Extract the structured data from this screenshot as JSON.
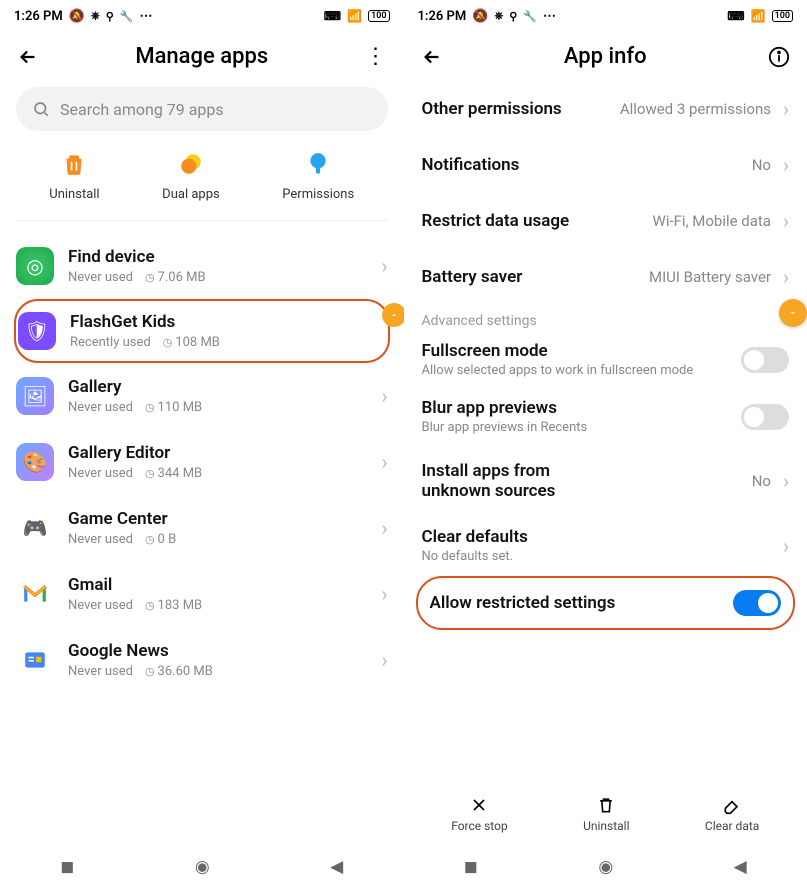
{
  "status": {
    "time": "1:26 PM",
    "battery_text": "100"
  },
  "screen1": {
    "title": "Manage apps",
    "search_placeholder": "Search among 79 apps",
    "quick_actions": {
      "uninstall": "Uninstall",
      "dual": "Dual apps",
      "permissions": "Permissions"
    },
    "apps": [
      {
        "name": "Find device",
        "usage": "Never used",
        "size": "7.06 MB"
      },
      {
        "name": "FlashGet Kids",
        "usage": "Recently used",
        "size": "108 MB"
      },
      {
        "name": "Gallery",
        "usage": "Never used",
        "size": "110 MB"
      },
      {
        "name": "Gallery Editor",
        "usage": "Never used",
        "size": "344 MB"
      },
      {
        "name": "Game Center",
        "usage": "Never used",
        "size": "0 B"
      },
      {
        "name": "Gmail",
        "usage": "Never used",
        "size": "183 MB"
      },
      {
        "name": "Google News",
        "usage": "Never used",
        "size": "36.60 MB"
      }
    ]
  },
  "screen2": {
    "title": "App info",
    "rows": {
      "other_permissions": {
        "label": "Other permissions",
        "value": "Allowed 3 permissions"
      },
      "notifications": {
        "label": "Notifications",
        "value": "No"
      },
      "restrict_data": {
        "label": "Restrict data usage",
        "value": "Wi-Fi, Mobile data"
      },
      "battery_saver": {
        "label": "Battery saver",
        "value": "MIUI Battery saver"
      }
    },
    "section": "Advanced settings",
    "fullscreen": {
      "label": "Fullscreen mode",
      "sub": "Allow selected apps to work in fullscreen mode"
    },
    "blur": {
      "label": "Blur app previews",
      "sub": "Blur app previews in Recents"
    },
    "unknown": {
      "label": "Install apps from unknown sources",
      "value": "No"
    },
    "clear_defaults": {
      "label": "Clear defaults",
      "sub": "No defaults set."
    },
    "allow_restricted": {
      "label": "Allow restricted settings"
    },
    "bottom": {
      "force_stop": "Force stop",
      "uninstall": "Uninstall",
      "clear_data": "Clear data"
    }
  }
}
